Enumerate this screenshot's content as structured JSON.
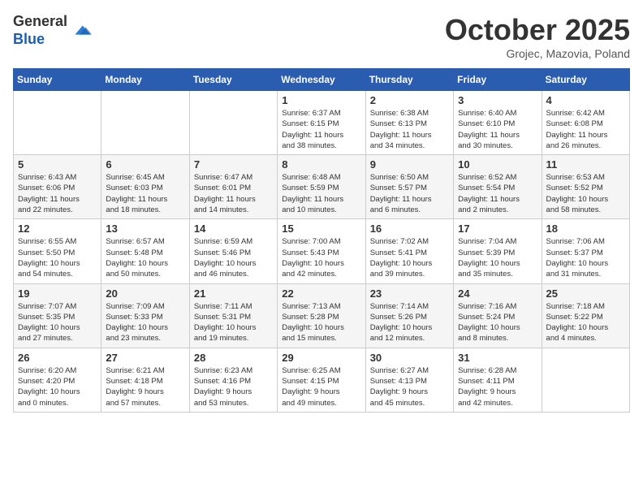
{
  "header": {
    "logo_general": "General",
    "logo_blue": "Blue",
    "month": "October 2025",
    "location": "Grojec, Mazovia, Poland"
  },
  "days_of_week": [
    "Sunday",
    "Monday",
    "Tuesday",
    "Wednesday",
    "Thursday",
    "Friday",
    "Saturday"
  ],
  "weeks": [
    [
      {
        "day": "",
        "info": ""
      },
      {
        "day": "",
        "info": ""
      },
      {
        "day": "",
        "info": ""
      },
      {
        "day": "1",
        "info": "Sunrise: 6:37 AM\nSunset: 6:15 PM\nDaylight: 11 hours\nand 38 minutes."
      },
      {
        "day": "2",
        "info": "Sunrise: 6:38 AM\nSunset: 6:13 PM\nDaylight: 11 hours\nand 34 minutes."
      },
      {
        "day": "3",
        "info": "Sunrise: 6:40 AM\nSunset: 6:10 PM\nDaylight: 11 hours\nand 30 minutes."
      },
      {
        "day": "4",
        "info": "Sunrise: 6:42 AM\nSunset: 6:08 PM\nDaylight: 11 hours\nand 26 minutes."
      }
    ],
    [
      {
        "day": "5",
        "info": "Sunrise: 6:43 AM\nSunset: 6:06 PM\nDaylight: 11 hours\nand 22 minutes."
      },
      {
        "day": "6",
        "info": "Sunrise: 6:45 AM\nSunset: 6:03 PM\nDaylight: 11 hours\nand 18 minutes."
      },
      {
        "day": "7",
        "info": "Sunrise: 6:47 AM\nSunset: 6:01 PM\nDaylight: 11 hours\nand 14 minutes."
      },
      {
        "day": "8",
        "info": "Sunrise: 6:48 AM\nSunset: 5:59 PM\nDaylight: 11 hours\nand 10 minutes."
      },
      {
        "day": "9",
        "info": "Sunrise: 6:50 AM\nSunset: 5:57 PM\nDaylight: 11 hours\nand 6 minutes."
      },
      {
        "day": "10",
        "info": "Sunrise: 6:52 AM\nSunset: 5:54 PM\nDaylight: 11 hours\nand 2 minutes."
      },
      {
        "day": "11",
        "info": "Sunrise: 6:53 AM\nSunset: 5:52 PM\nDaylight: 10 hours\nand 58 minutes."
      }
    ],
    [
      {
        "day": "12",
        "info": "Sunrise: 6:55 AM\nSunset: 5:50 PM\nDaylight: 10 hours\nand 54 minutes."
      },
      {
        "day": "13",
        "info": "Sunrise: 6:57 AM\nSunset: 5:48 PM\nDaylight: 10 hours\nand 50 minutes."
      },
      {
        "day": "14",
        "info": "Sunrise: 6:59 AM\nSunset: 5:46 PM\nDaylight: 10 hours\nand 46 minutes."
      },
      {
        "day": "15",
        "info": "Sunrise: 7:00 AM\nSunset: 5:43 PM\nDaylight: 10 hours\nand 42 minutes."
      },
      {
        "day": "16",
        "info": "Sunrise: 7:02 AM\nSunset: 5:41 PM\nDaylight: 10 hours\nand 39 minutes."
      },
      {
        "day": "17",
        "info": "Sunrise: 7:04 AM\nSunset: 5:39 PM\nDaylight: 10 hours\nand 35 minutes."
      },
      {
        "day": "18",
        "info": "Sunrise: 7:06 AM\nSunset: 5:37 PM\nDaylight: 10 hours\nand 31 minutes."
      }
    ],
    [
      {
        "day": "19",
        "info": "Sunrise: 7:07 AM\nSunset: 5:35 PM\nDaylight: 10 hours\nand 27 minutes."
      },
      {
        "day": "20",
        "info": "Sunrise: 7:09 AM\nSunset: 5:33 PM\nDaylight: 10 hours\nand 23 minutes."
      },
      {
        "day": "21",
        "info": "Sunrise: 7:11 AM\nSunset: 5:31 PM\nDaylight: 10 hours\nand 19 minutes."
      },
      {
        "day": "22",
        "info": "Sunrise: 7:13 AM\nSunset: 5:28 PM\nDaylight: 10 hours\nand 15 minutes."
      },
      {
        "day": "23",
        "info": "Sunrise: 7:14 AM\nSunset: 5:26 PM\nDaylight: 10 hours\nand 12 minutes."
      },
      {
        "day": "24",
        "info": "Sunrise: 7:16 AM\nSunset: 5:24 PM\nDaylight: 10 hours\nand 8 minutes."
      },
      {
        "day": "25",
        "info": "Sunrise: 7:18 AM\nSunset: 5:22 PM\nDaylight: 10 hours\nand 4 minutes."
      }
    ],
    [
      {
        "day": "26",
        "info": "Sunrise: 6:20 AM\nSunset: 4:20 PM\nDaylight: 10 hours\nand 0 minutes."
      },
      {
        "day": "27",
        "info": "Sunrise: 6:21 AM\nSunset: 4:18 PM\nDaylight: 9 hours\nand 57 minutes."
      },
      {
        "day": "28",
        "info": "Sunrise: 6:23 AM\nSunset: 4:16 PM\nDaylight: 9 hours\nand 53 minutes."
      },
      {
        "day": "29",
        "info": "Sunrise: 6:25 AM\nSunset: 4:15 PM\nDaylight: 9 hours\nand 49 minutes."
      },
      {
        "day": "30",
        "info": "Sunrise: 6:27 AM\nSunset: 4:13 PM\nDaylight: 9 hours\nand 45 minutes."
      },
      {
        "day": "31",
        "info": "Sunrise: 6:28 AM\nSunset: 4:11 PM\nDaylight: 9 hours\nand 42 minutes."
      },
      {
        "day": "",
        "info": ""
      }
    ]
  ]
}
